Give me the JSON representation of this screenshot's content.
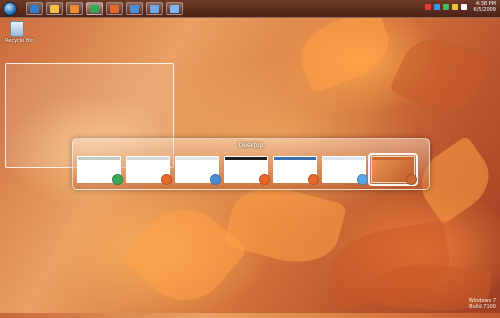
{
  "taskbar": {
    "buttons": [
      {
        "name": "ie-button",
        "icon": "internet-explorer-icon",
        "color": "#2f7fd0"
      },
      {
        "name": "explorer-button",
        "icon": "folder-icon",
        "color": "#f0c24a"
      },
      {
        "name": "media-player-button",
        "icon": "media-player-icon",
        "color": "#f08a2a"
      },
      {
        "name": "chrome-button",
        "icon": "chrome-icon",
        "color": "#3aa757"
      },
      {
        "name": "firefox-button",
        "icon": "firefox-icon",
        "color": "#e8672a"
      },
      {
        "name": "app-button-1",
        "icon": "app-icon",
        "color": "#4a8fd6"
      },
      {
        "name": "app-button-2",
        "icon": "window-icon",
        "color": "#6aa8e8"
      },
      {
        "name": "app-button-3",
        "icon": "monitor-icon",
        "color": "#7fb8f0"
      }
    ],
    "tray_icons": [
      "#e83a3a",
      "#2f9be8",
      "#3fbf5a",
      "#e8c53a",
      "#ffffff"
    ],
    "clock": {
      "time": "4:38 PM",
      "date": "6/5/2009"
    }
  },
  "desktop": {
    "recycle_bin_label": "Recycle Bin"
  },
  "flip": {
    "title": "Desktop",
    "windows": [
      {
        "icon": "chrome-icon",
        "badge_color": "#3aa757",
        "bar_color": "#c8c8c8"
      },
      {
        "icon": "firefox-icon",
        "badge_color": "#e8672a",
        "bar_color": "#d8d8d8"
      },
      {
        "icon": "app-icon",
        "badge_color": "#4a8fd6",
        "bar_color": "#e4e4e4"
      },
      {
        "icon": "firefox-icon",
        "badge_color": "#e8672a",
        "bar_color": "#222222"
      },
      {
        "icon": "firefox-icon",
        "badge_color": "#e8672a",
        "bar_color": "#3a6ea8"
      },
      {
        "icon": "explorer-icon",
        "badge_color": "#5aa8e8",
        "bar_color": "#dfe8f0"
      },
      {
        "icon": "desktop-icon",
        "badge_color": "#c86a30",
        "bar_color": "#c86a30"
      }
    ]
  },
  "branding": {
    "line1": "Windows 7",
    "line2": "Build 7100"
  }
}
